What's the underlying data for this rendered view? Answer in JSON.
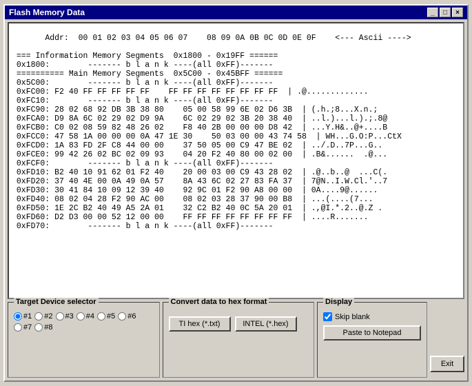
{
  "window": {
    "title": "Flash Memory Data",
    "close_label": "×",
    "minimize_label": "_",
    "maximize_label": "□"
  },
  "hex_content": {
    "header": " Addr:  00 01 02 03 04 05 06 07    08 09 0A 0B 0C 0D 0E 0F    <--- Ascii ---->",
    "lines": [
      " === Information Memory Segments  0x1800 - 0x19FF ======",
      "",
      " 0x1800:        ------- b l a n k ----(all 0xFF)-------",
      "",
      " ========== Main Memory Segments  0x5C00 - 0x45BFF ======",
      "",
      " 0x5C00:        ------- b l a n k ----(all 0xFF)-------",
      "",
      " 0xFC00: F2 40 FF FF FF FF FF    FF FF FF FF FF FF FF FF  | .@.............",
      " 0xFC10:        ------- b l a n k ----(all 0xFF)-------",
      "",
      " 0xFC90: 28 02 68 92 DB 3B 38 80    05 00 58 99 6E 02 D6 3B  | (.h.;8...X.n.;",
      " 0xFCA0: D9 8A 6C 02 29 02 D9 9A    6C 02 29 02 3B 20 38 40  | ..l.)...l.).;.8@",
      " 0xFCB0: C0 02 08 59 82 48 26 02    F8 40 2B 00 00 00 D8 42  | ...Y.H&..@+....B",
      " 0xFCC0: 47 58 1A 00 00 00 0A 47 1E 30    50 03 00 00 43 74 58  | WH...G.O:P...CtX",
      " 0xFCD0: 1A 83 FD 2F C8 44 00 00    37 50 05 00 C9 47 BE 02  | ../.D..7P...G..",
      " 0xFCE0: 99 42 26 02 BC 02 09 93    04 20 F2 40 80 00 02 00  | .B&......  .@...",
      " 0xFCF0:        ------- b l a n k ----(all 0xFF)-------",
      "",
      " 0xFD10: B2 40 10 91 62 01 F2 40    20 00 03 00 C9 43 28 02  | .@..b..@  ...C(.",
      " 0xFD20: 37 40 4E 00 0A 49 0A 57    8A 43 6C 02 27 83 FA 37  | 7@N..I.W.Cl.'..7",
      " 0xFD30: 30 41 84 10 09 12 39 40    92 9C 01 F2 90 A8 00 00  | 0A....9@......",
      " 0xFD40: 08 02 04 28 F2 90 AC 00    08 02 03 28 37 90 00 B8  | ...(....(7...",
      " 0xFD50: 1E 2C B2 40 49 A5 2A 01    32 C2 B2 40 0C 5A 20 01  | .,@I.*.2..@.Z .",
      " 0xFD60: D2 D3 00 00 52 12 00 00    FF FF FF FF FF FF FF FF  | ....R.......",
      " 0xFD70:        ------- b l a n k ----(all 0xFF)-------"
    ]
  },
  "target_device": {
    "label": "Target Device selector",
    "options": [
      "#1",
      "#2",
      "#3",
      "#4",
      "#5",
      "#6",
      "#7",
      "#8"
    ],
    "selected": "#1"
  },
  "convert": {
    "label": "Convert data to hex format",
    "ti_hex_label": "TI hex (*.txt)",
    "intel_hex_label": "INTEL (*.hex)"
  },
  "display": {
    "label": "Display",
    "skip_blank_label": "Skip blank",
    "skip_blank_checked": true,
    "paste_label": "Paste to Notepad"
  },
  "exit": {
    "label": "Exit"
  }
}
